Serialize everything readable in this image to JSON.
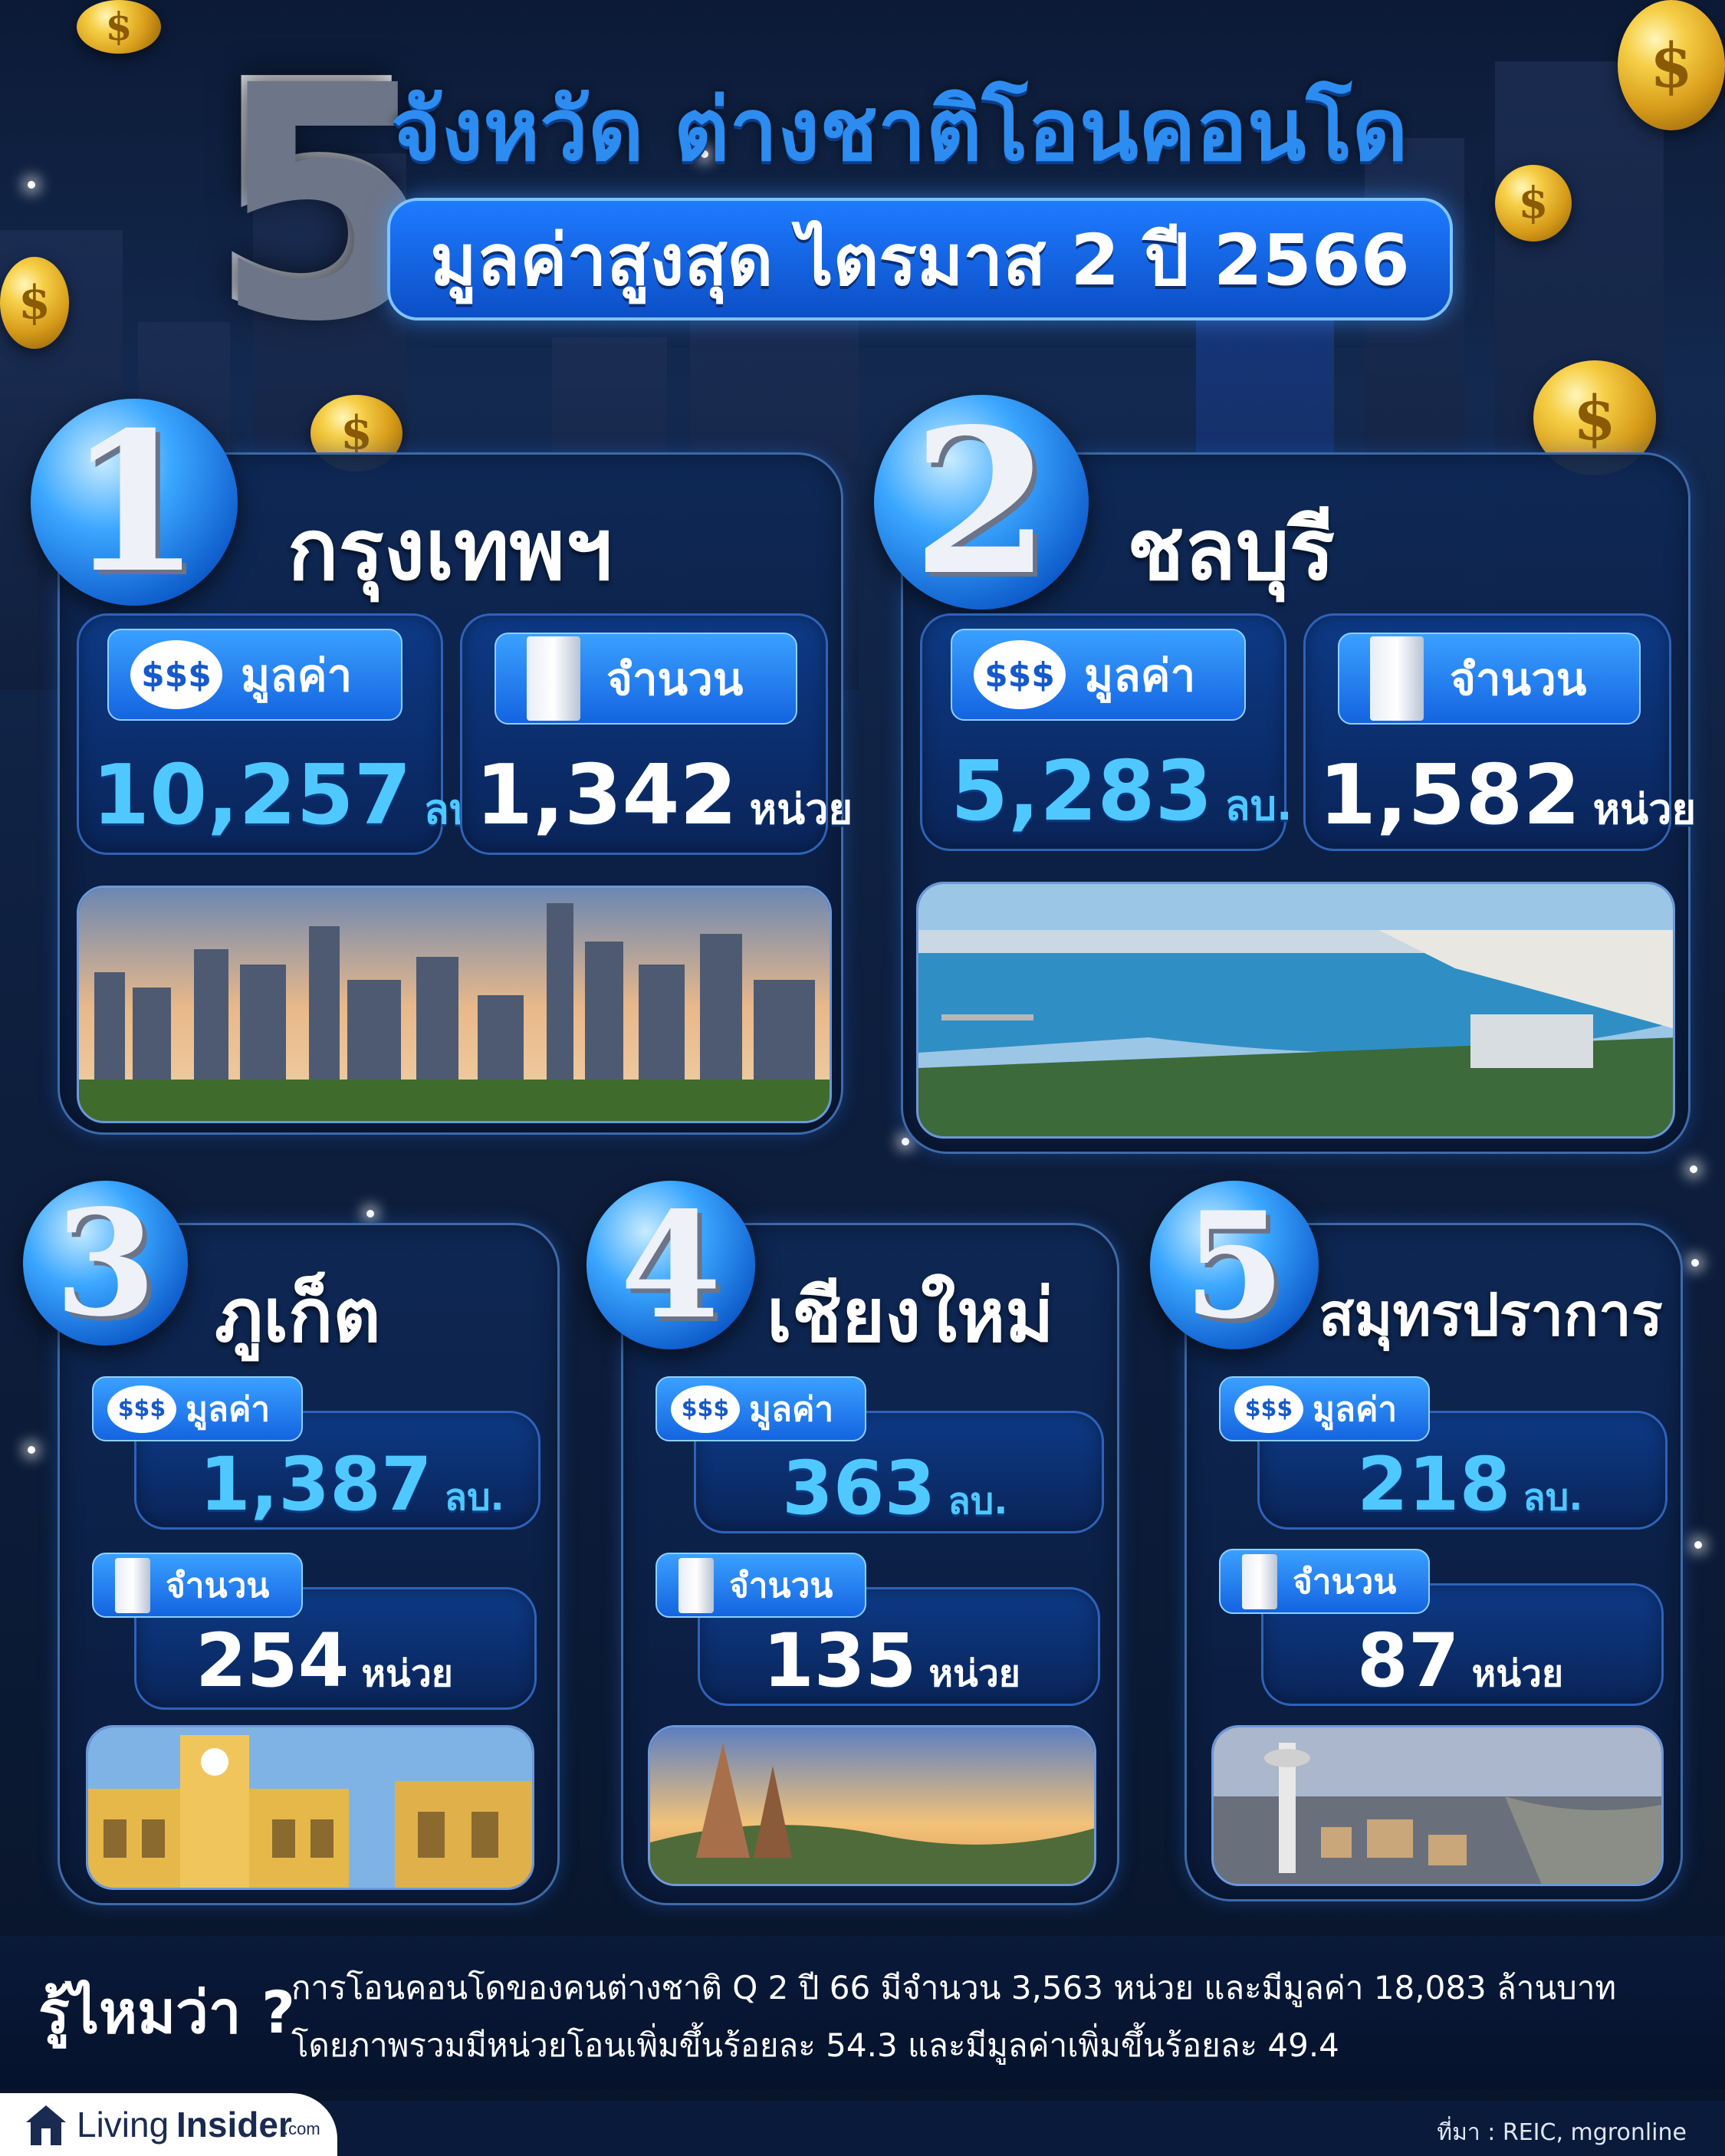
{
  "header": {
    "big_number": "5",
    "title_line1": "จังหวัด ต่างชาติโอนคอนโด",
    "title_line2": "มูลค่าสูงสุด ไตรมาส 2 ปี 2566"
  },
  "coin_symbol": "$",
  "labels": {
    "value": "มูลค่า",
    "count": "จำนวน",
    "value_unit": "ลบ.",
    "count_unit": "หน่วย"
  },
  "provinces": [
    {
      "rank": "1",
      "name": "กรุงเทพฯ",
      "value": "10,257",
      "count": "1,342"
    },
    {
      "rank": "2",
      "name": "ชลบุรี",
      "value": "5,283",
      "count": "1,582"
    },
    {
      "rank": "3",
      "name": "ภูเก็ต",
      "value": "1,387",
      "count": "254"
    },
    {
      "rank": "4",
      "name": "เชียงใหม่",
      "value": "363",
      "count": "135"
    },
    {
      "rank": "5",
      "name": "สมุทรปราการ",
      "value": "218",
      "count": "87"
    }
  ],
  "footer": {
    "did_you_know": "รู้ไหมว่า ?",
    "line1": "การโอนคอนโดของคนต่างชาติ Q 2 ปี 66 มีจำนวน 3,563 หน่วย และมีมูลค่า 18,083 ล้านบาท",
    "line2": "โดยภาพรวมมีหน่วยโอนเพิ่มขึ้นร้อยละ 54.3 และมีมูลค่าเพิ่มขึ้นร้อยละ 49.4",
    "logo_living": "Living",
    "logo_insider": "Insider",
    "logo_com": ".com",
    "source": "ที่มา : REIC, mgronline"
  },
  "colors": {
    "accent_blue": "#2d8cf0",
    "value_blue": "#4fc8ff",
    "background": "#0e1f3f",
    "coin_gold": "#f6cf47"
  },
  "icons": [
    "money-bag-icon",
    "building-icon",
    "coin-icon",
    "living-insider-logo"
  ]
}
